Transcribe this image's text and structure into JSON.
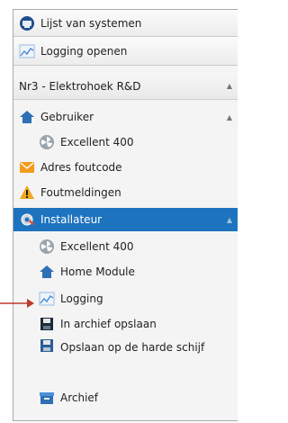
{
  "toolbar": {
    "systems_label": "Lijst van systemen",
    "logging_label": "Logging openen"
  },
  "system": {
    "name": "Nr3 - Elektrohoek R&D"
  },
  "tree": {
    "gebruiker": "Gebruiker",
    "excellent1": "Excellent 400",
    "adres": "Adres foutcode",
    "fout": "Foutmeldingen",
    "installateur": "Installateur",
    "excellent2": "Excellent 400",
    "home": "Home Module",
    "logging": "Logging",
    "archief_opslaan": "In archief opslaan",
    "harde_schijf": "Opslaan op de harde schijf",
    "archief": "Archief"
  },
  "colors": {
    "selected": "#1e73be",
    "pointer": "#c0392b"
  }
}
